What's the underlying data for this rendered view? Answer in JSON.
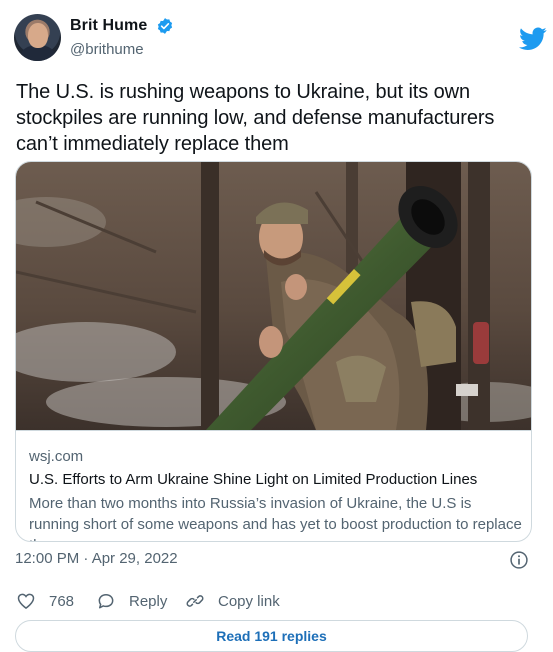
{
  "author": {
    "name": "Brit Hume",
    "handle": "@brithume",
    "verified_icon": "verified-badge-icon",
    "platform_icon": "twitter-bird-icon"
  },
  "tweet": {
    "text": "The U.S. is rushing weapons to Ukraine, but its own stockpiles are running low, and defense manufacturers can’t immediately replace them",
    "timestamp": "12:00 PM · Apr 29, 2022"
  },
  "card": {
    "domain": "wsj.com",
    "title": "U.S. Efforts to Arm Ukraine Shine Light on Limited Production Lines",
    "description": "More than two months into Russia’s invasion of Ukraine, the U.S is running short of some weapons and has yet to boost production to replace the ..."
  },
  "actions": {
    "like_count": "768",
    "reply_label": "Reply",
    "copy_link_label": "Copy link"
  },
  "footer": {
    "read_replies_label": "Read 191 replies"
  },
  "colors": {
    "twitter_blue": "#1d9bf0",
    "muted_text": "#536471",
    "link_blue": "#1d6fb8"
  }
}
